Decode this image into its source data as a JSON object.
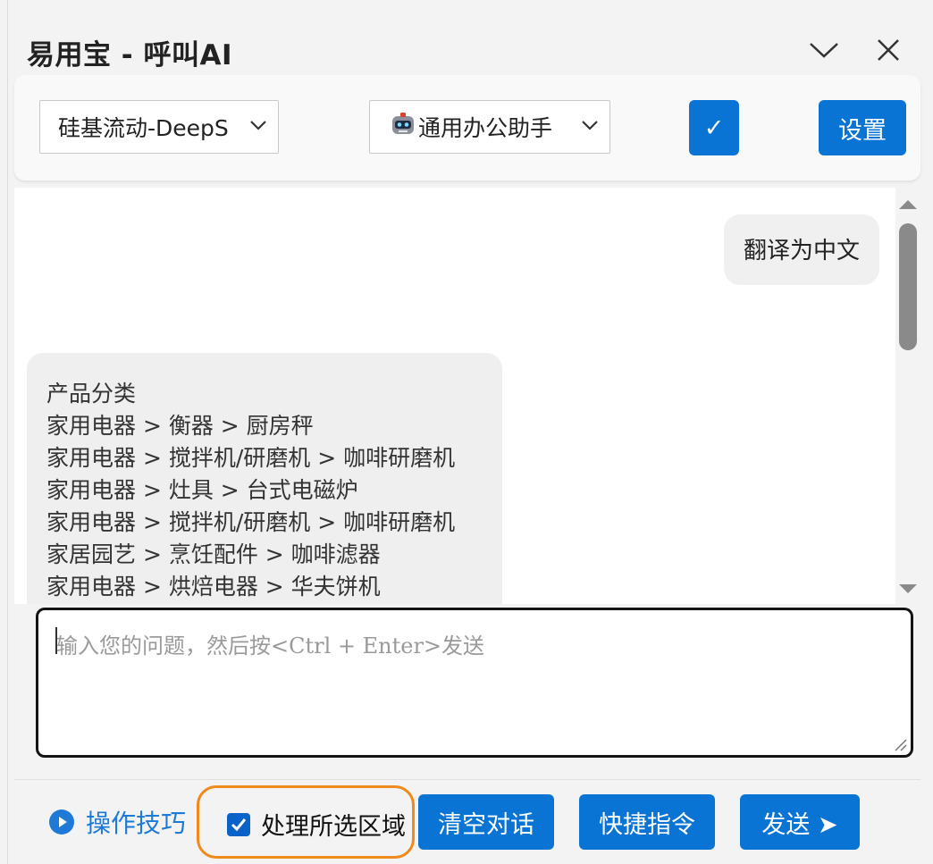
{
  "window": {
    "title": "易用宝 - 呼叫AI",
    "minimize_icon": "chevron-down-icon",
    "close_icon": "close-icon"
  },
  "toolbar": {
    "model_select": {
      "value": "硅基流动-DeepS"
    },
    "assistant_select": {
      "value": "通用办公助手",
      "icon": "robot-icon"
    },
    "confirm_label": "✓",
    "settings_label": "设置"
  },
  "chat": {
    "messages": [
      {
        "role": "user",
        "text": "翻译为中文"
      },
      {
        "role": "assistant",
        "lines": [
          "产品分类",
          "家用电器 > 衡器 > 厨房秤",
          "家用电器 > 搅拌机/研磨机 > 咖啡研磨机",
          "家用电器 > 灶具 > 台式电磁炉",
          "家用电器 > 搅拌机/研磨机 > 咖啡研磨机",
          "家居园艺 > 烹饪配件 > 咖啡滤器",
          "家用电器 > 烘焙电器 > 华夫饼机"
        ]
      }
    ]
  },
  "input": {
    "value": "",
    "placeholder": "输入您的问题，然后按<Ctrl + Enter>发送"
  },
  "bottom": {
    "tips_label": "操作技巧",
    "process_region_label": "处理所选区域",
    "process_region_checked": true,
    "clear_label": "清空对话",
    "shortcut_label": "快捷指令",
    "send_label": "发送 ➤"
  },
  "colors": {
    "accent": "#0a74d4",
    "highlight_outline": "#ef8a1c",
    "link": "#1e7ad6"
  }
}
